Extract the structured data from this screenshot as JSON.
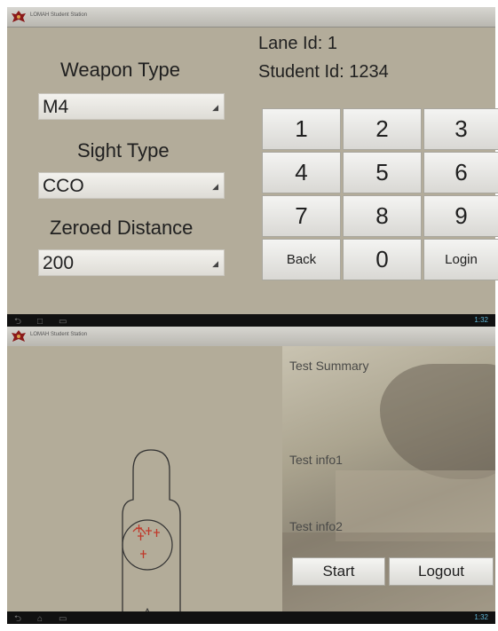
{
  "screen1": {
    "app_title": "LOMAH Student Station",
    "weapon_type_label": "Weapon Type",
    "weapon_type_value": "M4",
    "sight_type_label": "Sight Type",
    "sight_type_value": "CCO",
    "zeroed_distance_label": "Zeroed Distance",
    "zeroed_distance_value": "200",
    "lane_id_label": "Lane Id: 1",
    "student_id_label": "Student Id: 1234",
    "keypad": {
      "keys": [
        "1",
        "2",
        "3",
        "4",
        "5",
        "6",
        "7",
        "8",
        "9",
        "Back",
        "0",
        "Login"
      ]
    },
    "status_time": "1:32"
  },
  "screen2": {
    "app_title": "LOMAH Student Station",
    "test_summary": "Test Summary",
    "test_info1": "Test info1",
    "test_info2": "Test info2",
    "start_button": "Start",
    "logout_button": "Logout",
    "status_time": "1:32"
  },
  "colors": {
    "background": "#b3ac9a",
    "title_bar": "#c8c6c0",
    "hit_marks": "#c0392b"
  }
}
